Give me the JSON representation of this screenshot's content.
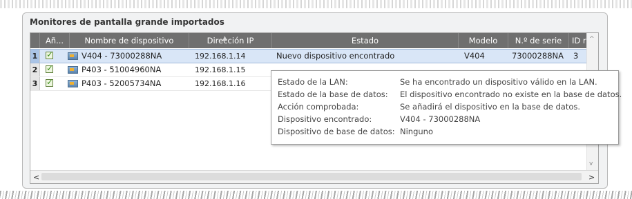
{
  "panel": {
    "title": "Monitores de pantalla grande importados"
  },
  "columns": [
    "Añ...",
    "Nombre de dispositivo",
    "Dirección IP",
    "Estado",
    "Modelo",
    "N.º de serie",
    "ID r"
  ],
  "rows": [
    {
      "index": "1",
      "checked": true,
      "name": "V404 - 73000288NA",
      "ip": "192.168.1.14",
      "status": "Nuevo dispositivo encontrado",
      "model": "V404",
      "serial": "73000288NA",
      "id": "3"
    },
    {
      "index": "2",
      "checked": true,
      "name": "P403 - 51004960NA",
      "ip": "192.168.1.15"
    },
    {
      "index": "3",
      "checked": true,
      "name": "P403 - 52005734NA",
      "ip": "192.168.1.16"
    }
  ],
  "tooltip": {
    "items": [
      {
        "label": "Estado de la LAN:",
        "value": "Se ha encontrado un dispositivo válido en la LAN."
      },
      {
        "label": "Estado de la base de datos:",
        "value": "El dispositivo encontrado no existe en la base de datos."
      },
      {
        "label": "Acción comprobada:",
        "value": "Se añadirá el dispositivo en la base de datos."
      },
      {
        "label": "Dispositivo encontrado:",
        "value": "V404 - 73000288NA"
      },
      {
        "label": "Dispositivo de base de datos:",
        "value": "Ninguno"
      }
    ]
  },
  "scrollbars": {
    "left_arrow": "<",
    "right_arrow": ">",
    "up_arrow": "^",
    "down_arrow": "v"
  },
  "colors": {
    "header": "#6f6f6f",
    "selected_row": "#d9e6f7",
    "check": "#3d8b1d"
  },
  "icons": {
    "check": "checkbox-checked-icon",
    "device": "display-device-icon"
  }
}
